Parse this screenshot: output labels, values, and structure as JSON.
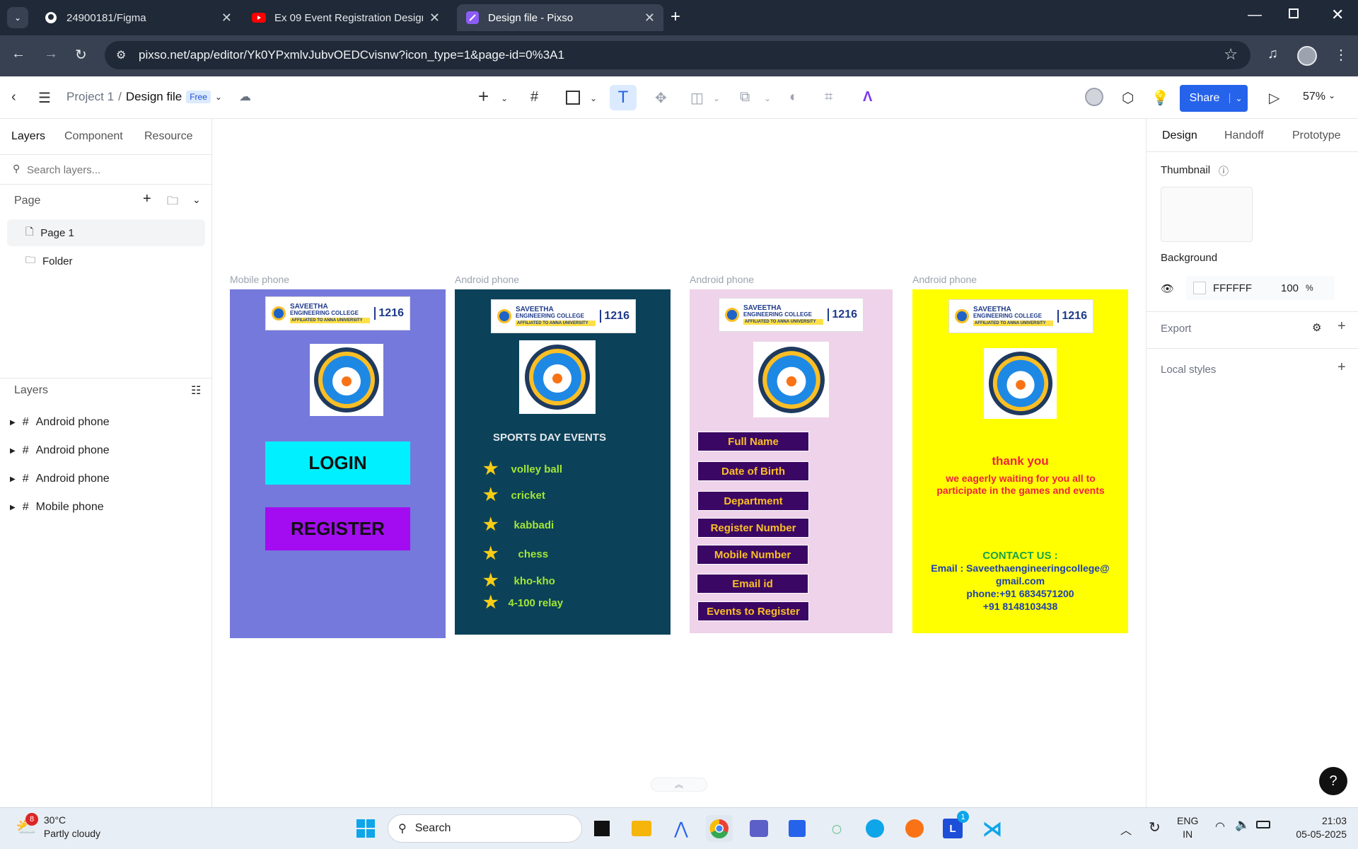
{
  "browser": {
    "tabs": [
      {
        "title": "24900181/Figma",
        "icon": "github-icon"
      },
      {
        "title": "Ex 09 Event Registration Design",
        "icon": "youtube-icon"
      },
      {
        "title": "Design file - Pixso",
        "icon": "pixso-icon"
      }
    ],
    "url": "pixso.net/app/editor/Yk0YPxmlvJubvOEDCvisnw?icon_type=1&page-id=0%3A1"
  },
  "toolbar": {
    "breadcrumb_project": "Project 1",
    "breadcrumb_sep": "/",
    "breadcrumb_file": "Design file",
    "plan_badge": "Free",
    "share_label": "Share",
    "zoom": "57%"
  },
  "left_panel": {
    "tabs": [
      "Layers",
      "Component",
      "Resource"
    ],
    "search_placeholder": "Search layers...",
    "page_section": "Page",
    "pages": [
      "Page 1",
      "Folder"
    ],
    "layers_section": "Layers",
    "layers": [
      "Android phone",
      "Android phone",
      "Android phone",
      "Mobile phone"
    ]
  },
  "right_panel": {
    "tabs": [
      "Design",
      "Handoff",
      "Prototype"
    ],
    "thumbnail_label": "Thumbnail",
    "background_label": "Background",
    "bg_hex": "FFFFFF",
    "bg_opacity": "100",
    "bg_opacity_unit": "%",
    "export_label": "Export",
    "local_styles_label": "Local styles"
  },
  "canvas": {
    "frame_labels": [
      "Mobile phone",
      "Android phone",
      "Android phone",
      "Android phone"
    ],
    "college": {
      "name1": "SAVEETHA",
      "name2": "ENGINEERING COLLEGE",
      "affil": "AFFILIATED TO ANNA UNIVERSITY",
      "code": "1216"
    },
    "frame1": {
      "login": "LOGIN",
      "register": "REGISTER",
      "bg": "#7579dc"
    },
    "frame2": {
      "title": "SPORTS DAY EVENTS",
      "events": [
        "volley ball",
        "cricket",
        "kabbadi",
        "chess",
        "kho-kho",
        "4-100 relay"
      ],
      "bg": "#0b4259"
    },
    "frame3": {
      "fields": [
        "Full Name",
        "Date of Birth",
        "Department",
        "Register Number",
        "Mobile Number",
        "Email id",
        "Events to Register"
      ],
      "bg": "#eed3ea"
    },
    "frame4": {
      "thanks": "thank you",
      "message": "we eagerly waiting for you all to participate in the games and events",
      "contact_title": "CONTACT US :",
      "email_line1": "Email  : Saveethaengineeringcollege@",
      "email_line2": "gmail.com",
      "phone1": "phone:+91 6834571200",
      "phone2": "+91 8148103438",
      "bg": "#ffff00"
    }
  },
  "taskbar": {
    "weather_badge": "8",
    "temp": "30°C",
    "condition": "Partly cloudy",
    "search": "Search",
    "lang1": "ENG",
    "lang2": "IN",
    "time": "21:03",
    "date": "05-05-2025",
    "app_badge": "1"
  }
}
